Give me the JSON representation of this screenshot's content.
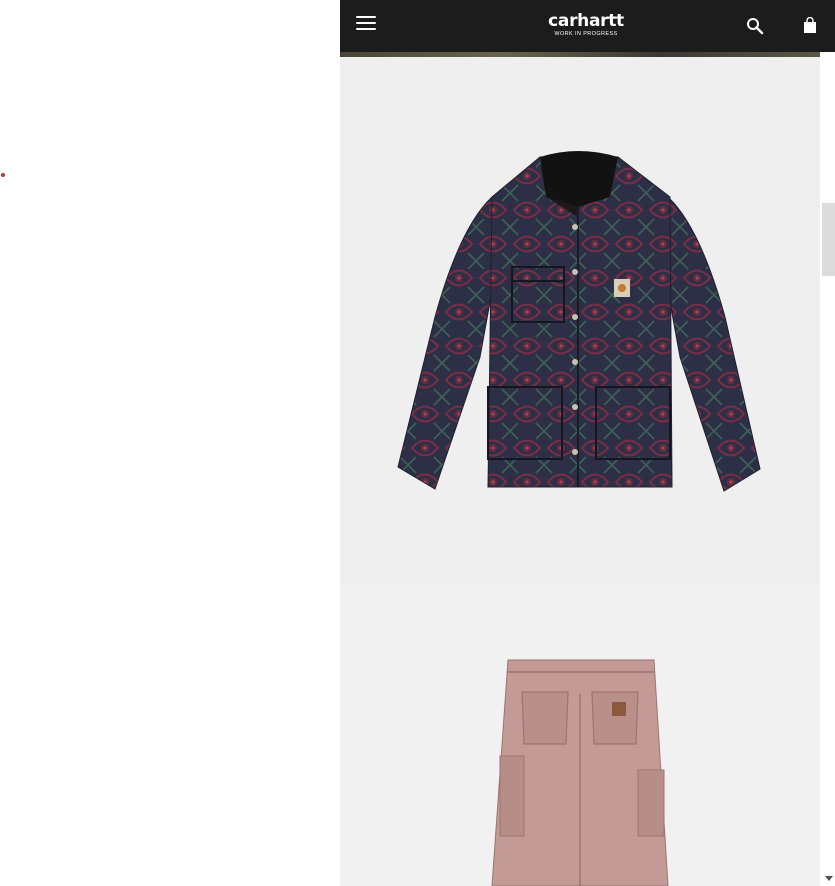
{
  "header": {
    "brand": "carhartt",
    "tagline": "WORK IN PROGRESS",
    "menu_icon": "hamburger-menu-icon",
    "search_icon": "search-icon",
    "cart_icon": "shopping-bag-icon"
  },
  "colors": {
    "header_bg": "#1c1c1c",
    "card_bg": "#efefef",
    "accent_dot": "#c0392b"
  },
  "products": [
    {
      "image": "patterned-chore-jacket",
      "color_family": "navy paisley"
    },
    {
      "image": "double-knee-carpenter-pants",
      "color_family": "dusty pink"
    }
  ]
}
